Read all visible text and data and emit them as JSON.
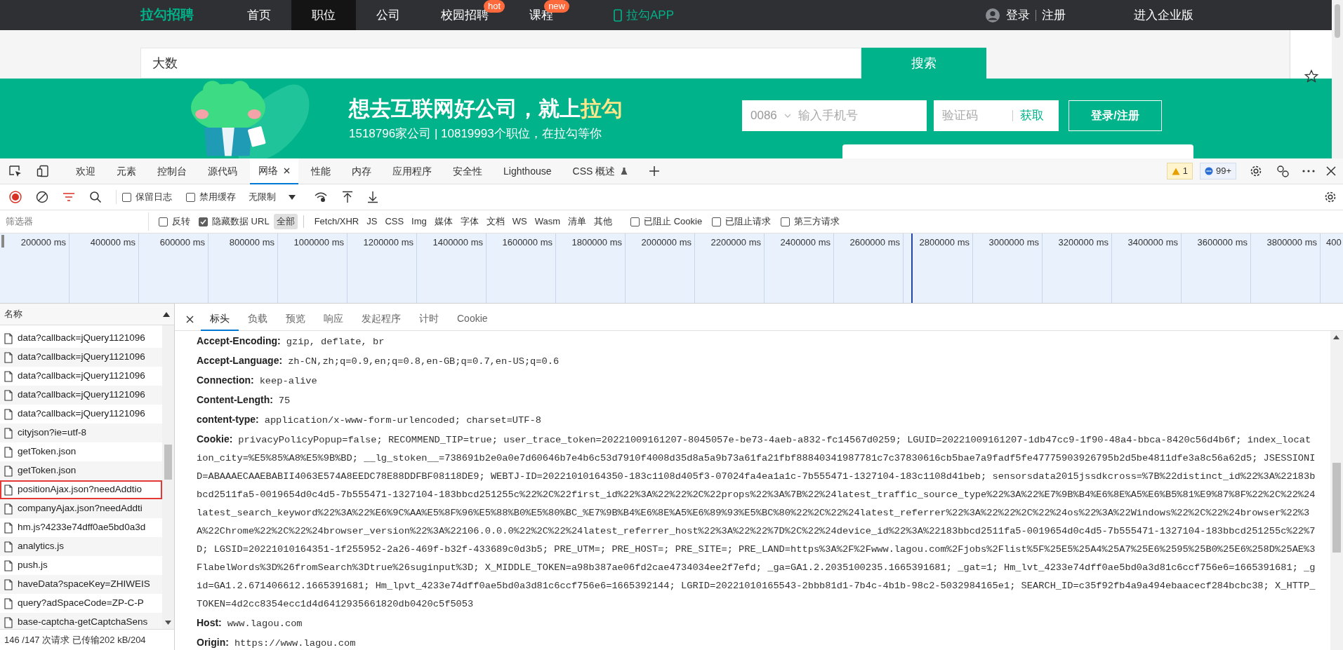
{
  "site_nav": {
    "logo": "拉勾招聘",
    "items": [
      {
        "label": "首页",
        "selected": false
      },
      {
        "label": "职位",
        "selected": true
      },
      {
        "label": "公司",
        "selected": false
      },
      {
        "label": "校园招聘",
        "selected": false,
        "badge": "hot"
      },
      {
        "label": "课程",
        "selected": false,
        "badge": "new"
      },
      {
        "label": "拉勾APP",
        "selected": false,
        "kind": "app"
      }
    ],
    "login": "登录",
    "register": "注册",
    "enterprise": "进入企业版"
  },
  "search": {
    "value": "大数",
    "button": "搜索"
  },
  "banner": {
    "headline": "想去互联网好公司，就上",
    "headline_highlight": "拉勾",
    "subtitle": "1518796家公司 | 10819993个职位，在拉勾等你",
    "country_code": "0086",
    "phone_placeholder": "输入手机号",
    "code_placeholder": "验证码",
    "get_code": "获取",
    "login_button": "登录/注册"
  },
  "devtools": {
    "tabs": [
      {
        "label": "欢迎",
        "selected": false
      },
      {
        "label": "元素",
        "selected": false
      },
      {
        "label": "控制台",
        "selected": false
      },
      {
        "label": "源代码",
        "selected": false
      },
      {
        "label": "网络",
        "selected": true,
        "closable": true
      },
      {
        "label": "性能",
        "selected": false
      },
      {
        "label": "内存",
        "selected": false
      },
      {
        "label": "应用程序",
        "selected": false
      },
      {
        "label": "安全性",
        "selected": false
      },
      {
        "label": "Lighthouse",
        "selected": false
      },
      {
        "label": "CSS 概述",
        "selected": false,
        "experimental": true
      }
    ],
    "warnings": "1",
    "messages": "99+",
    "toolbar": {
      "recording": true,
      "preserve_log": {
        "label": "保留日志",
        "checked": false
      },
      "disable_cache": {
        "label": "禁用缓存",
        "checked": false
      },
      "throttle": "无限制"
    },
    "filter": {
      "placeholder": "筛选器",
      "options": [
        {
          "label": "反转",
          "checked": false
        },
        {
          "label": "隐藏数据 URL",
          "checked": true
        }
      ],
      "types": [
        {
          "label": "全部",
          "selected": true
        },
        {
          "label": "Fetch/XHR",
          "selected": false
        },
        {
          "label": "JS",
          "selected": false
        },
        {
          "label": "CSS",
          "selected": false
        },
        {
          "label": "Img",
          "selected": false
        },
        {
          "label": "媒体",
          "selected": false
        },
        {
          "label": "字体",
          "selected": false
        },
        {
          "label": "文档",
          "selected": false
        },
        {
          "label": "WS",
          "selected": false
        },
        {
          "label": "Wasm",
          "selected": false
        },
        {
          "label": "清单",
          "selected": false
        },
        {
          "label": "其他",
          "selected": false
        }
      ],
      "more_options": [
        {
          "label": "已阻止 Cookie",
          "checked": false
        },
        {
          "label": "已阻止请求",
          "checked": false
        },
        {
          "label": "第三方请求",
          "checked": false
        }
      ]
    },
    "timeline": {
      "ticks": [
        "200000 ms",
        "400000 ms",
        "600000 ms",
        "800000 ms",
        "1000000 ms",
        "1200000 ms",
        "1400000 ms",
        "1600000 ms",
        "1800000 ms",
        "2000000 ms",
        "2200000 ms",
        "2400000 ms",
        "2600000 ms",
        "2800000 ms",
        "3000000 ms",
        "3200000 ms",
        "3400000 ms",
        "3600000 ms",
        "3800000 ms",
        "400"
      ]
    },
    "requests": {
      "column": "名称",
      "rows": [
        {
          "name": "data?callback=jQuery1121096",
          "outlined": false
        },
        {
          "name": "data?callback=jQuery1121096",
          "outlined": false
        },
        {
          "name": "data?callback=jQuery1121096",
          "outlined": false
        },
        {
          "name": "data?callback=jQuery1121096",
          "outlined": false
        },
        {
          "name": "data?callback=jQuery1121096",
          "outlined": false
        },
        {
          "name": "cityjson?ie=utf-8",
          "outlined": false
        },
        {
          "name": "getToken.json",
          "outlined": false
        },
        {
          "name": "getToken.json",
          "outlined": false
        },
        {
          "name": "positionAjax.json?needAddtio",
          "outlined": true
        },
        {
          "name": "companyAjax.json?needAddti",
          "outlined": false
        },
        {
          "name": "hm.js?4233e74dff0ae5bd0a3d",
          "outlined": false
        },
        {
          "name": "analytics.js",
          "outlined": false
        },
        {
          "name": "push.js",
          "outlined": false
        },
        {
          "name": "haveData?spaceKey=ZHIWEIS",
          "outlined": false
        },
        {
          "name": "query?adSpaceCode=ZP-C-P",
          "outlined": false
        },
        {
          "name": "base-captcha-getCaptchaSens",
          "outlined": false
        }
      ]
    },
    "status": "146 /147 次请求  已传输202 kB/204",
    "detail": {
      "tabs": [
        {
          "label": "标头",
          "selected": true
        },
        {
          "label": "负载",
          "selected": false
        },
        {
          "label": "预览",
          "selected": false
        },
        {
          "label": "响应",
          "selected": false
        },
        {
          "label": "发起程序",
          "selected": false
        },
        {
          "label": "计时",
          "selected": false
        },
        {
          "label": "Cookie",
          "selected": false
        }
      ],
      "headers": [
        {
          "name": "Accept-Encoding:",
          "value": "gzip, deflate, br"
        },
        {
          "name": "Accept-Language:",
          "value": "zh-CN,zh;q=0.9,en;q=0.8,en-GB;q=0.7,en-US;q=0.6"
        },
        {
          "name": "Connection:",
          "value": "keep-alive"
        },
        {
          "name": "Content-Length:",
          "value": "75"
        },
        {
          "name": "content-type:",
          "value": "application/x-www-form-urlencoded; charset=UTF-8"
        },
        {
          "name": "Cookie:",
          "value": "privacyPolicyPopup=false; RECOMMEND_TIP=true; user_trace_token=20221009161207-8045057e-be73-4aeb-a832-fc14567d0259; LGUID=20221009161207-1db47cc9-1f90-48a4-bbca-8420c56d4b6f; index_location_city=%E5%85%A8%E5%9B%BD; __lg_stoken__=738691b2e0a0e7d60646b7e4b6c53d7910f4008d35d8a5a9b73a61fa21fbf88840341987781c7c37830616cb5bae7a9fadf5fe47775903926795b2d5be4811dfe3a8c56a62d5; JSESSIONID=ABAAAECAAEBABII4063E574A8EEDC78E88DDFBF08118DE9; WEBTJ-ID=20221010164350-183c1108d405f3-07024fa4ea1a1c-7b555471-1327104-183c1108d41beb; sensorsdata2015jssdkcross=%7B%22distinct_id%22%3A%22183bbcd2511fa5-0019654d0c4d5-7b555471-1327104-183bbcd251255c%22%2C%22first_id%22%3A%22%22%2C%22props%22%3A%7B%22%24latest_traffic_source_type%22%3A%22%E7%9B%B4%E6%8E%A5%E6%B5%81%E9%87%8F%22%2C%22%24latest_search_keyword%22%3A%22%E6%9C%AA%E5%8F%96%E5%88%B0%E5%80%BC_%E7%9B%B4%E6%8E%A5%E6%89%93%E5%BC%80%22%2C%22%24latest_referrer%22%3A%22%22%2C%22%24os%22%3A%22Windows%22%2C%22%24browser%22%3A%22Chrome%22%2C%22%24browser_version%22%3A%22106.0.0.0%22%2C%22%24latest_referrer_host%22%3A%22%22%7D%2C%22%24device_id%22%3A%22183bbcd2511fa5-0019654d0c4d5-7b555471-1327104-183bbcd251255c%22%7D; LGSID=20221010164351-1f255952-2a26-469f-b32f-433689c0d3b5; PRE_UTM=; PRE_HOST=; PRE_SITE=; PRE_LAND=https%3A%2F%2Fwww.lagou.com%2Fjobs%2Flist%5F%25E5%25A4%25A7%25E6%2595%25B0%25E6%258D%25AE%3FlabelWords%3D%26fromSearch%3Dtrue%26suginput%3D; X_MIDDLE_TOKEN=a98b387ae06fd2cae4734034ee2f7efd; _ga=GA1.2.2035100235.1665391681; _gat=1; Hm_lvt_4233e74dff0ae5bd0a3d81c6ccf756e6=1665391681; _gid=GA1.2.671406612.1665391681; Hm_lpvt_4233e74dff0ae5bd0a3d81c6ccf756e6=1665392144; LGRID=20221010165543-2bbb81d1-7b4c-4b1b-98c2-5032984165e1; SEARCH_ID=c35f92fb4a9a494ebaacecf284bcbc38; X_HTTP_TOKEN=4d2cc8354ecc1d4d6412935661820db0420c5f5053"
        },
        {
          "name": "Host:",
          "value": "www.lagou.com"
        },
        {
          "name": "Origin:",
          "value": "https://www.lagou.com"
        }
      ]
    }
  }
}
